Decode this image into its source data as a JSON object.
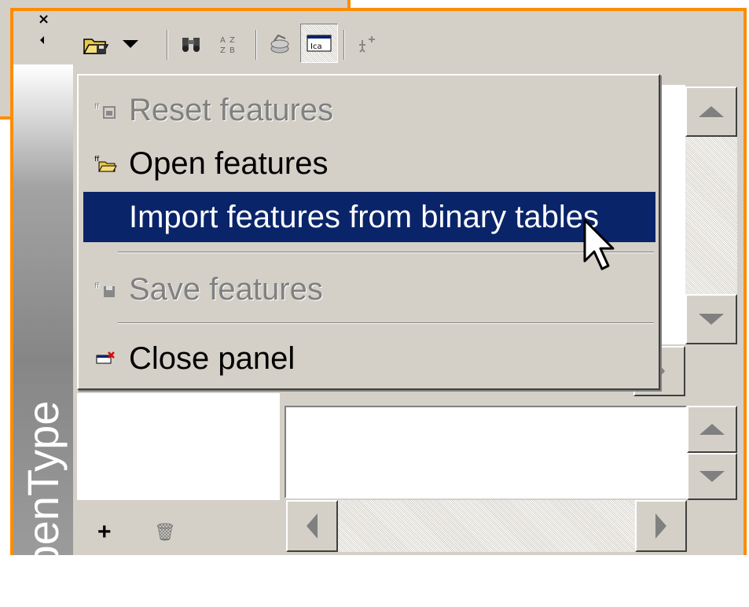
{
  "panel": {
    "title": "OpenType",
    "close_glyph": "×"
  },
  "toolbar": {
    "buttons": [
      {
        "name": "open-features-icon"
      },
      {
        "name": "dropdown-arrow-icon"
      },
      {
        "name": "binoculars-icon"
      },
      {
        "name": "sort-icon"
      },
      {
        "name": "apply-icon"
      },
      {
        "name": "code-editor-icon"
      },
      {
        "name": "add-feature-icon"
      }
    ]
  },
  "menu": {
    "items": [
      {
        "label": "Reset features",
        "enabled": false,
        "icon": "reset-features-icon"
      },
      {
        "label": "Open features",
        "enabled": true,
        "icon": "open-features-icon"
      },
      {
        "label": "Import features from binary tables",
        "enabled": true,
        "selected": true,
        "icon": ""
      },
      {
        "label": "Save features",
        "enabled": false,
        "icon": "save-features-icon"
      },
      {
        "label": "Close panel",
        "enabled": true,
        "icon": "close-panel-icon"
      }
    ]
  },
  "bottom_bar": {
    "add_glyph": "+",
    "delete_glyph": "🗑"
  },
  "colors": {
    "frame": "#ff8c00",
    "face": "#d4d0c8",
    "highlight": "#0a246a"
  }
}
